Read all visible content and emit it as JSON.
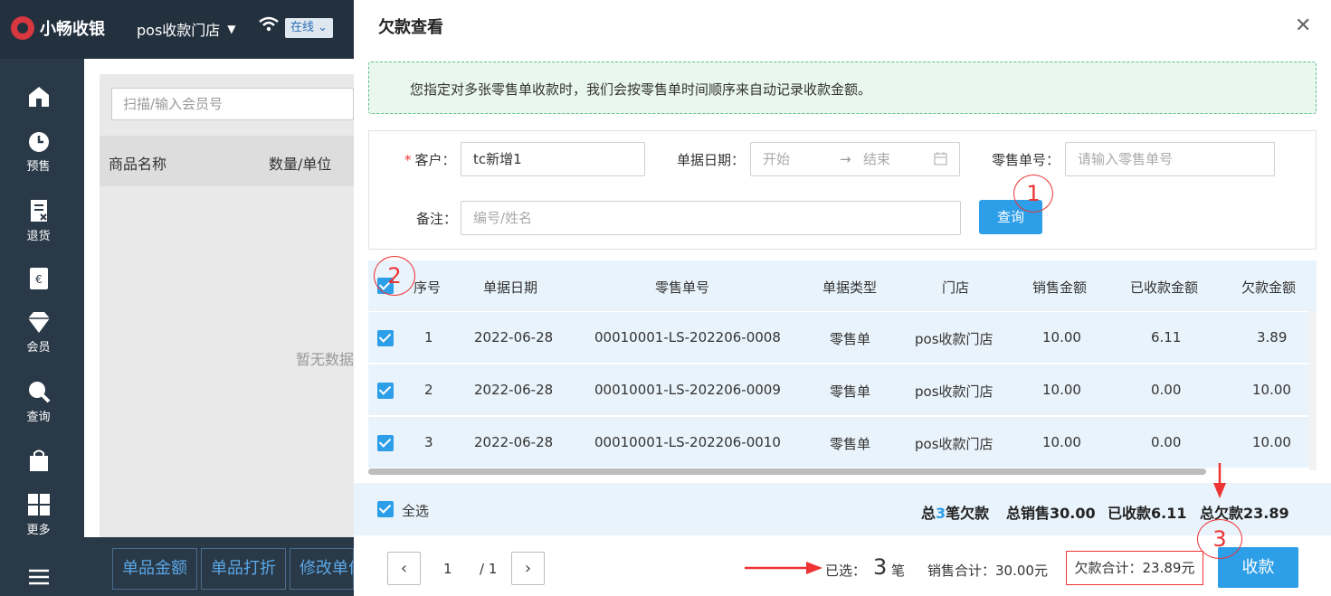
{
  "app": {
    "logo": "小畅收银",
    "store": "pos收款门店",
    "online": "在线"
  },
  "sidenav": [
    {
      "label": ""
    },
    {
      "label": "预售"
    },
    {
      "label": "退货"
    },
    {
      "label": ""
    },
    {
      "label": "会员"
    },
    {
      "label": "查询"
    },
    {
      "label": ""
    },
    {
      "label": "更多"
    }
  ],
  "left": {
    "scan_placeholder": "扫描/输入会员号",
    "col_name": "商品名称",
    "col_qty": "数量/单位",
    "empty": "暂无数据",
    "btn_price": "单品金额",
    "btn_discount": "单品打折",
    "btn_edit": "修改单价"
  },
  "modal": {
    "title": "欠款查看",
    "notice": "您指定对多张零售单收款时，我们会按零售单时间顺序来自动记录收款金额。",
    "filter": {
      "customer_label": "客户：",
      "customer_value": "tc新增1",
      "date_label": "单据日期：",
      "date_start": "开始",
      "date_end": "结束",
      "retail_no_label": "零售单号：",
      "retail_no_placeholder": "请输入零售单号",
      "remark_label": "备注：",
      "remark_placeholder": "编号/姓名",
      "query_button": "查询"
    },
    "table": {
      "headers": [
        "序号",
        "单据日期",
        "零售单号",
        "单据类型",
        "门店",
        "销售金额",
        "已收款金额",
        "欠款金额"
      ],
      "rows": [
        {
          "no": "1",
          "date": "2022-06-28",
          "retail_no": "00010001-LS-202206-0008",
          "type": "零售单",
          "store": "pos收款门店",
          "sales": "10.00",
          "received": "6.11",
          "debt": "3.89"
        },
        {
          "no": "2",
          "date": "2022-06-28",
          "retail_no": "00010001-LS-202206-0009",
          "type": "零售单",
          "store": "pos收款门店",
          "sales": "10.00",
          "received": "0.00",
          "debt": "10.00"
        },
        {
          "no": "3",
          "date": "2022-06-28",
          "retail_no": "00010001-LS-202206-0010",
          "type": "零售单",
          "store": "pos收款门店",
          "sales": "10.00",
          "received": "0.00",
          "debt": "10.00"
        }
      ]
    },
    "summary": {
      "select_all": "全选",
      "total_prefix": "总",
      "total_count": "3",
      "total_suffix": "笔欠款",
      "total_sales": "总销售30.00",
      "total_received": "已收款6.11",
      "total_debt": "总欠款23.89"
    },
    "footer": {
      "page_current": "1",
      "page_total": "/ 1",
      "selected_label": "已选：",
      "selected_count": "3",
      "selected_unit": "笔",
      "sales_total": "销售合计：30.00元",
      "debt_total": "欠款合计：23.89元",
      "collect_button": "收款"
    },
    "annotations": [
      "1",
      "2",
      "3"
    ]
  }
}
